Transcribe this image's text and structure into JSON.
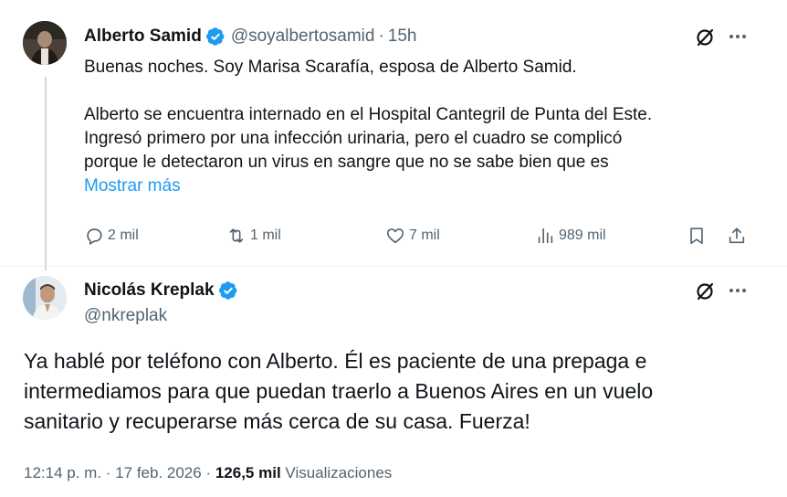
{
  "tweet": {
    "author": {
      "name": "Alberto Samid",
      "handle": "@soyalbertosamid",
      "time": "15h",
      "verified_color": "#1d9bf0"
    },
    "text": [
      "Buenas noches. Soy Marisa Scarafía, esposa de Alberto Samid.",
      "Alberto se encuentra internado en el Hospital Cantegril de Punta del Este.",
      "Ingresó primero por una infección urinaria,  pero el cuadro se complicó",
      "porque le detectaron un virus en sangre que no se sabe bien que es"
    ],
    "show_more_label": "Mostrar más",
    "stats": {
      "replies": "2 mil",
      "retweets": "1 mil",
      "likes": "7 mil",
      "views": "989 mil"
    },
    "icons": [
      "grok-icon",
      "more-icon",
      "reply-icon",
      "retweet-icon",
      "like-icon",
      "views-icon",
      "bookmark-icon",
      "share-icon"
    ]
  },
  "reply": {
    "author": {
      "name": "Nicolás Kreplak",
      "handle": "@nkreplak"
    },
    "text": [
      "Ya hablé por teléfono con Alberto. Él es paciente de una prepaga e",
      "intermediamos para que puedan traerlo a Buenos Aires en un vuelo",
      "sanitario y recuperarse más cerca de su casa. Fuerza!"
    ],
    "meta": {
      "time": "12:14 p. m.",
      "date": "17 feb. 2026",
      "views_count": "126,5 mil",
      "views_label": "Visualizaciones"
    }
  },
  "colors": {
    "accent": "#1d9bf0",
    "secondary_text": "#536471",
    "primary_text": "#0f1419",
    "thread_line": "#cfd9de"
  }
}
